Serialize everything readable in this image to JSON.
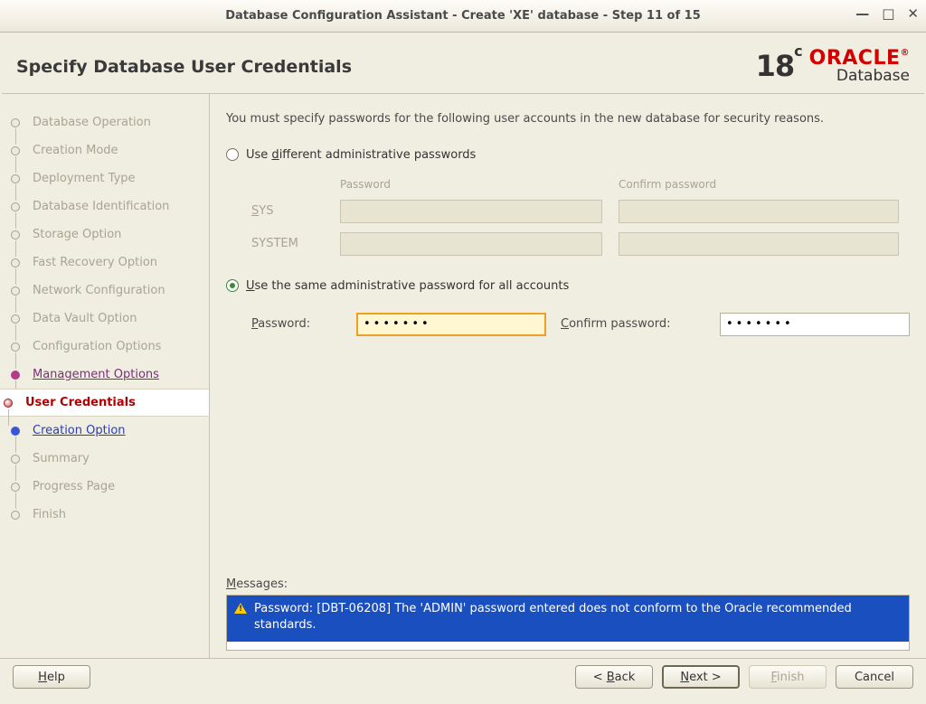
{
  "window": {
    "title": "Database Configuration Assistant - Create 'XE' database - Step 11 of 15"
  },
  "header": {
    "page_title": "Specify Database User Credentials",
    "brand_version": "18",
    "brand_suffix": "c",
    "brand_name": "ORACLE",
    "brand_tm": "®",
    "brand_product": "Database"
  },
  "sidebar": {
    "steps": [
      {
        "label": "Database Operation",
        "state": "done"
      },
      {
        "label": "Creation Mode",
        "state": "done"
      },
      {
        "label": "Deployment Type",
        "state": "done"
      },
      {
        "label": "Database Identification",
        "state": "done"
      },
      {
        "label": "Storage Option",
        "state": "done"
      },
      {
        "label": "Fast Recovery Option",
        "state": "done"
      },
      {
        "label": "Network Configuration",
        "state": "done"
      },
      {
        "label": "Data Vault Option",
        "state": "done"
      },
      {
        "label": "Configuration Options",
        "state": "done"
      },
      {
        "label": "Management Options",
        "state": "prev"
      },
      {
        "label": "User Credentials",
        "state": "current"
      },
      {
        "label": "Creation Option",
        "state": "next"
      },
      {
        "label": "Summary",
        "state": "future"
      },
      {
        "label": "Progress Page",
        "state": "future"
      },
      {
        "label": "Finish",
        "state": "future"
      }
    ]
  },
  "content": {
    "intro": "You must specify passwords for the following user accounts in the new database for security reasons.",
    "option_different": {
      "label_pre": "Use ",
      "label_u": "d",
      "label_post": "ifferent administrative passwords",
      "selected": false
    },
    "table": {
      "head_password": "Password",
      "head_confirm": "Confirm password",
      "rows": [
        {
          "name": "SYS",
          "u": "S",
          "rest": "YS"
        },
        {
          "name": "SYSTEM",
          "u": "",
          "rest": "SYSTEM"
        }
      ]
    },
    "option_same": {
      "label_pre": "",
      "label_u": "U",
      "label_post": "se the same administrative password for all accounts",
      "selected": true
    },
    "same": {
      "password_label_u": "P",
      "password_label_rest": "assword:",
      "confirm_label_u": "C",
      "confirm_label_rest": "onfirm password:",
      "password_value": "•••••••",
      "confirm_value": "•••••••"
    },
    "messages_label_u": "M",
    "messages_label_rest": "essages:",
    "messages": [
      "Password: [DBT-06208] The 'ADMIN' password entered does not conform to the Oracle recommended standards."
    ]
  },
  "footer": {
    "help_u": "H",
    "help_rest": "elp",
    "back_pre": "< ",
    "back_u": "B",
    "back_rest": "ack",
    "next_u": "N",
    "next_rest": "ext >",
    "finish_u": "F",
    "finish_rest": "inish",
    "cancel": "Cancel"
  }
}
